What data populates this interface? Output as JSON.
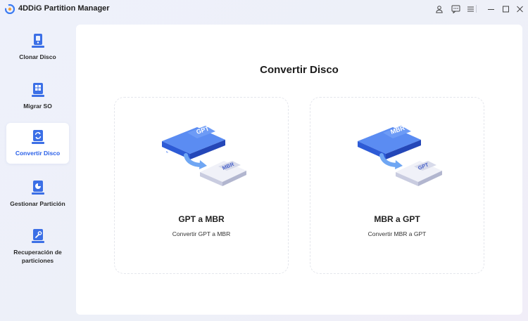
{
  "window": {
    "title": "4DDiG Partition Manager"
  },
  "sidebar": {
    "items": [
      {
        "label": "Clonar Disco",
        "icon": "clone-disk-icon",
        "active": false
      },
      {
        "label": "Migrar SO",
        "icon": "migrate-os-icon",
        "active": false
      },
      {
        "label": "Convertir Disco",
        "icon": "convert-disk-icon",
        "active": true
      },
      {
        "label": "Gestionar Partición",
        "icon": "manage-partition-icon",
        "active": false
      },
      {
        "label": "Recuperación de particiones",
        "icon": "partition-recovery-icon",
        "active": false
      }
    ]
  },
  "main": {
    "title": "Convertir Disco",
    "cards": [
      {
        "title": "GPT a MBR",
        "description": "Convertir GPT a MBR",
        "from": "GPT",
        "to": "MBR"
      },
      {
        "title": "MBR a GPT",
        "description": "Convertir MBR a GPT",
        "from": "MBR",
        "to": "GPT"
      }
    ]
  },
  "colors": {
    "accent": "#2a60e8",
    "disk_blue": "#3b6fe6",
    "disk_light": "#e7e9f5"
  }
}
